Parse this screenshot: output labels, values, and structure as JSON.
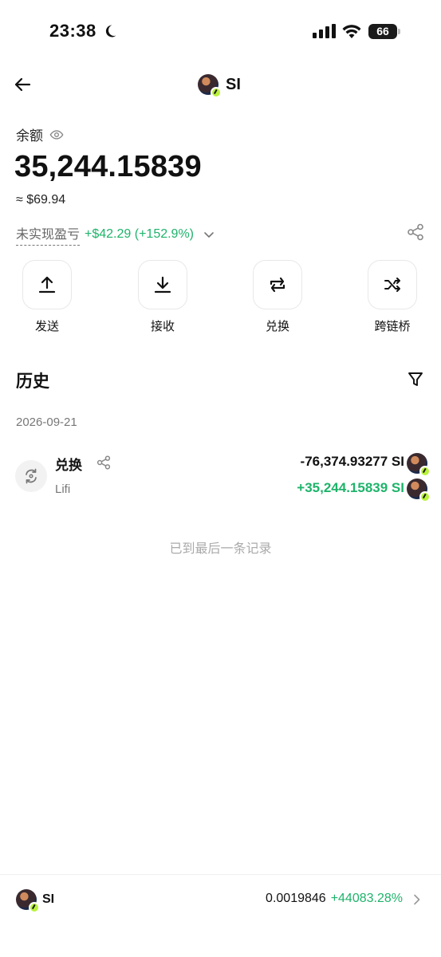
{
  "status_bar": {
    "time": "23:38",
    "battery": "66"
  },
  "header": {
    "token_name": "SI"
  },
  "balance": {
    "label": "余额",
    "amount": "35,244.15839",
    "fiat": "≈ $69.94",
    "pnl_label": "未实现盈亏",
    "pnl_value": "+$42.29 (+152.9%)"
  },
  "actions": [
    {
      "label": "发送",
      "icon": "upload-icon"
    },
    {
      "label": "接收",
      "icon": "download-icon"
    },
    {
      "label": "兑换",
      "icon": "swap-icon"
    },
    {
      "label": "跨链桥",
      "icon": "shuffle-icon"
    }
  ],
  "history": {
    "title": "历史",
    "groups": [
      {
        "date": "2026-09-21",
        "items": [
          {
            "title": "兑换",
            "subtitle": "Lifi",
            "amount_out": "-76,374.93277 SI",
            "amount_in": "+35,244.15839 SI"
          }
        ]
      }
    ],
    "end_note": "已到最后一条记录"
  },
  "bottom_bar": {
    "token_name": "SI",
    "price": "0.0019846",
    "change": "+44083.28%"
  },
  "colors": {
    "positive": "#1fb36b",
    "text": "#111111",
    "muted": "#777777"
  }
}
